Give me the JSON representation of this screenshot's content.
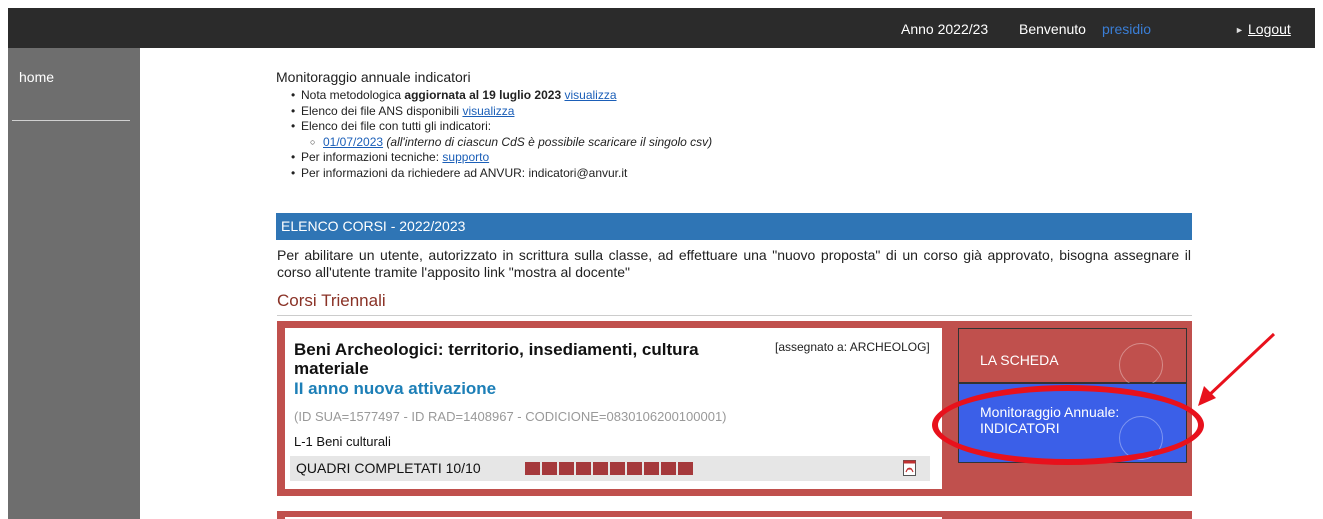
{
  "header": {
    "year": "Anno 2022/23",
    "welcome": "Benvenuto",
    "username": "presidio",
    "logout": "Logout"
  },
  "sidebar": {
    "home": "home"
  },
  "intro": {
    "title": "Monitoraggio annuale indicatori",
    "items": [
      {
        "text": "Nota metodologica ",
        "bold": "aggiornata al 19 luglio 2023",
        "link": "visualizza"
      },
      {
        "text": "Elenco dei file ANS disponibili",
        "link": "visualizza"
      },
      {
        "text": "Elenco dei file con tutti gli indicatori:"
      },
      {
        "link": "01/07/2023",
        "italic": "(all'interno di ciascun CdS è possibile scaricare il singolo csv)"
      },
      {
        "text": "Per informazioni tecniche:",
        "link": "supporto"
      },
      {
        "text": "Per informazioni da richiedere ad ANVUR: indicatori@anvur.it"
      }
    ]
  },
  "section": {
    "header": "ELENCO CORSI - 2022/2023",
    "notice": "Per abilitare un utente, autorizzato in scrittura sulla classe, ad effettuare una \"nuovo proposta\" di un corso già approvato, bisogna assegnare il corso all'utente tramite l'apposito link \"mostra al docente\"",
    "group": "Corsi Triennali"
  },
  "course": {
    "title": "Beni Archeologici: territorio, insediamenti, cultura materiale",
    "assigned": "[assegnato a: ARCHEOLOG]",
    "subtitle": "II anno nuova attivazione",
    "ids": "(ID SUA=1577497 - ID RAD=1408967 - CODICIONE=0830106200100001)",
    "class": "L-1 Beni culturali",
    "quadri": "QUADRI COMPLETATI 10/10",
    "quadri_completed": 10,
    "quadri_total": 10,
    "scheda_button": "LA SCHEDA",
    "monitoraggio_button_line1": "Monitoraggio Annuale:",
    "monitoraggio_button_line2": "INDICATORI"
  },
  "colors": {
    "topbar": "#2b2b2b",
    "sidebar": "#6e6e6e",
    "section_header": "#2f75b5",
    "course_bg": "#c0504d",
    "monitoraggio_bg": "#3b5fe8",
    "annotation": "#e8111c"
  }
}
